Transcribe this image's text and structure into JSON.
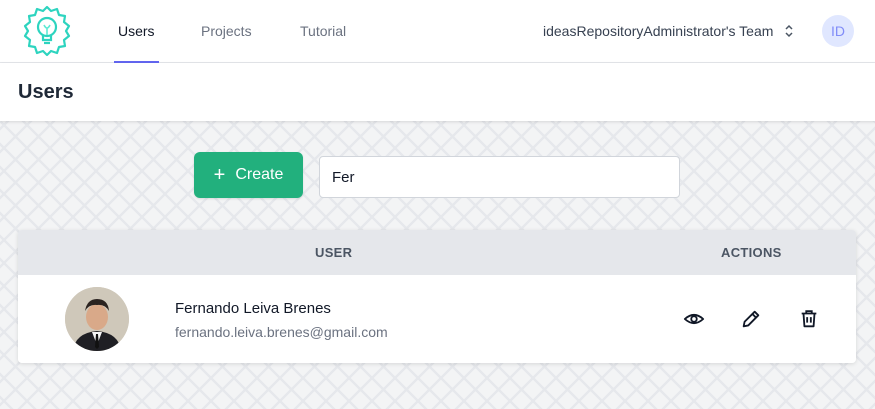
{
  "nav": {
    "logo": "lightbulb-logo",
    "tabs": [
      {
        "label": "Users",
        "active": true
      },
      {
        "label": "Projects",
        "active": false
      },
      {
        "label": "Tutorial",
        "active": false
      }
    ],
    "team": "ideasRepositoryAdministrator's Team",
    "avatar_initials": "ID"
  },
  "header": {
    "title": "Users"
  },
  "toolbar": {
    "create_label": "Create",
    "create_icon": "plus-icon",
    "search_value": "Fer"
  },
  "table": {
    "columns": [
      "USER",
      "ACTIONS"
    ],
    "rows": [
      {
        "name": "Fernando Leiva Brenes",
        "email": "fernando.leiva.brenes@gmail.com",
        "actions": [
          "eye-icon",
          "pencil-icon",
          "trash-icon"
        ]
      }
    ]
  },
  "colors": {
    "accent": "#6366f1",
    "create_button": "#22b07d",
    "logo": "#2dd4bf"
  }
}
